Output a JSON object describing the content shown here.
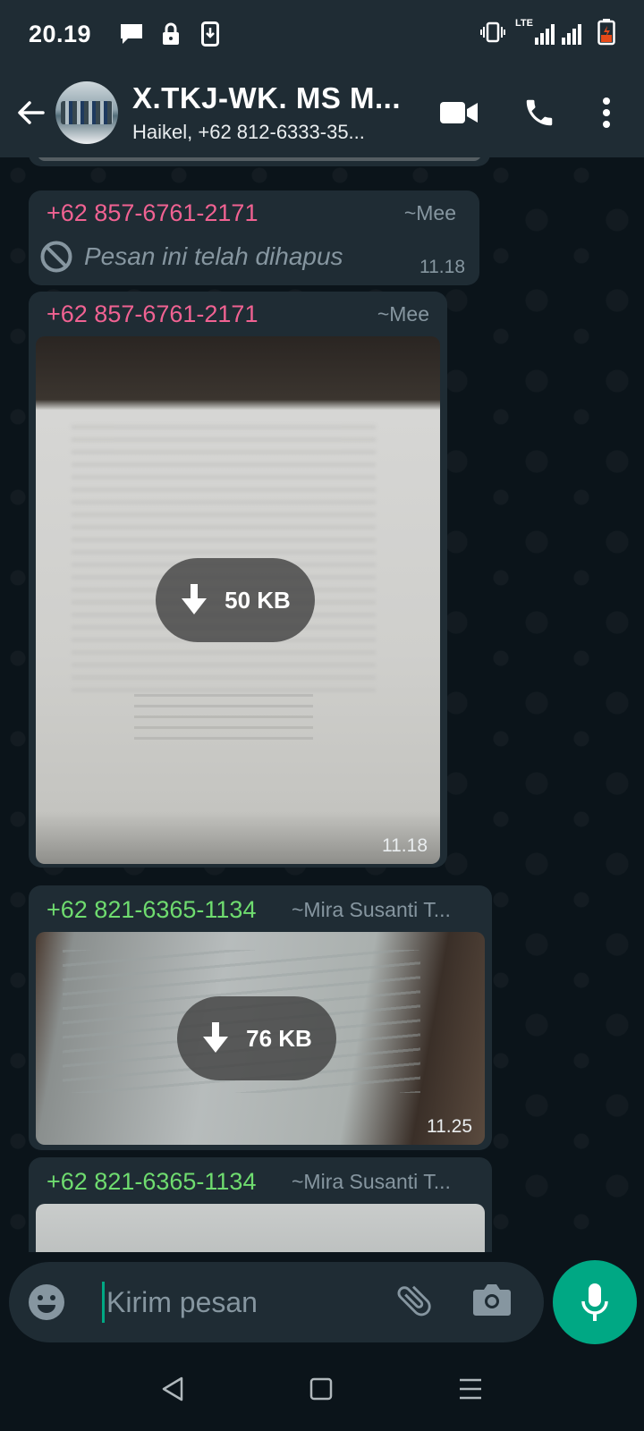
{
  "status_bar": {
    "time": "20.19",
    "network_label": "LTE",
    "icons": [
      "message-icon",
      "lock-icon",
      "download-icon",
      "vibrate-icon",
      "signal-icon",
      "battery-icon"
    ]
  },
  "header": {
    "title": "X.TKJ-WK. MS M...",
    "subtitle": "Haikel, +62 812-6333-35...",
    "icons": [
      "back-arrow-icon",
      "video-call-icon",
      "phone-icon",
      "more-vert-icon"
    ]
  },
  "messages": [
    {
      "sender": "+62 857-6761-2171",
      "alias": "~Mee",
      "text": "Pesan ini telah dihapus",
      "time": "11.18",
      "type": "deleted"
    },
    {
      "sender": "+62 857-6761-2171",
      "alias": "~Mee",
      "size": "50 KB",
      "time": "11.18",
      "type": "image"
    },
    {
      "sender": "+62 821-6365-1134",
      "alias": "~Mira Susanti T...",
      "size": "76 KB",
      "time": "11.25",
      "type": "image"
    },
    {
      "sender": "+62 821-6365-1134",
      "alias": "~Mira Susanti T...",
      "type": "image"
    }
  ],
  "composer": {
    "placeholder": "Kirim pesan",
    "icons": [
      "emoji-icon",
      "attach-icon",
      "camera-icon",
      "mic-icon"
    ]
  },
  "colors": {
    "accent": "#00a884",
    "sender_pink": "#f06292",
    "sender_green": "#6fdc6f",
    "bubble": "#1f2c34",
    "background": "#0b141a"
  }
}
